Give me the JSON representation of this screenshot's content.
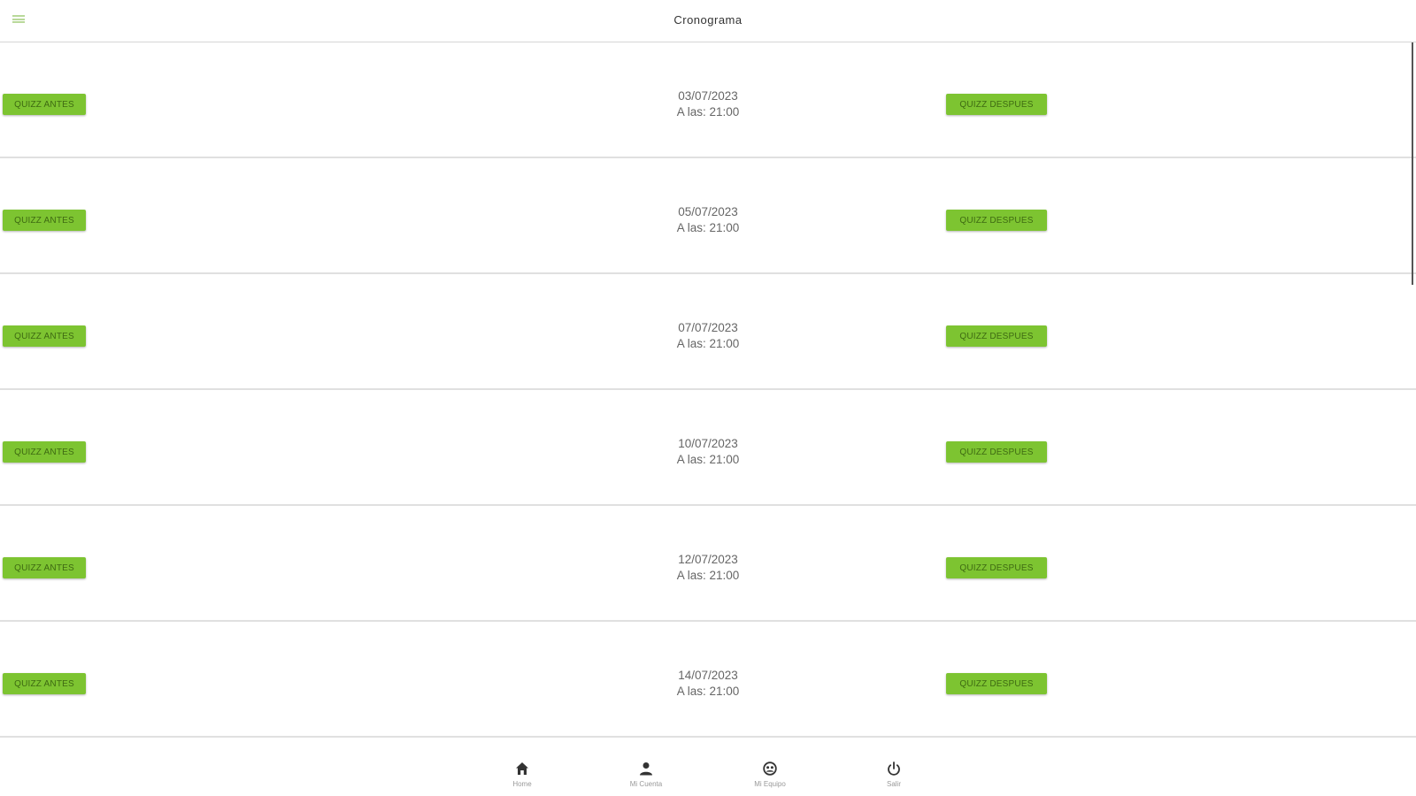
{
  "header": {
    "title": "Cronograma"
  },
  "list": {
    "before_label": "QUIZZ ANTES",
    "after_label": "QUIZZ DESPUES",
    "items": [
      {
        "date": "03/07/2023",
        "time": "A las: 21:00"
      },
      {
        "date": "05/07/2023",
        "time": "A las: 21:00"
      },
      {
        "date": "07/07/2023",
        "time": "A las: 21:00"
      },
      {
        "date": "10/07/2023",
        "time": "A las: 21:00"
      },
      {
        "date": "12/07/2023",
        "time": "A las: 21:00"
      },
      {
        "date": "14/07/2023",
        "time": "A las: 21:00"
      }
    ]
  },
  "nav": {
    "items": [
      {
        "label": "Home",
        "icon": "home-icon"
      },
      {
        "label": "Mi Cuenta",
        "icon": "person-icon"
      },
      {
        "label": "Mi Equipo",
        "icon": "team-icon"
      },
      {
        "label": "Salir",
        "icon": "power-icon"
      }
    ]
  },
  "colors": {
    "accent": "#7dc431",
    "accent_text": "#3e6a12",
    "menu_icon": "#b9d99a"
  }
}
